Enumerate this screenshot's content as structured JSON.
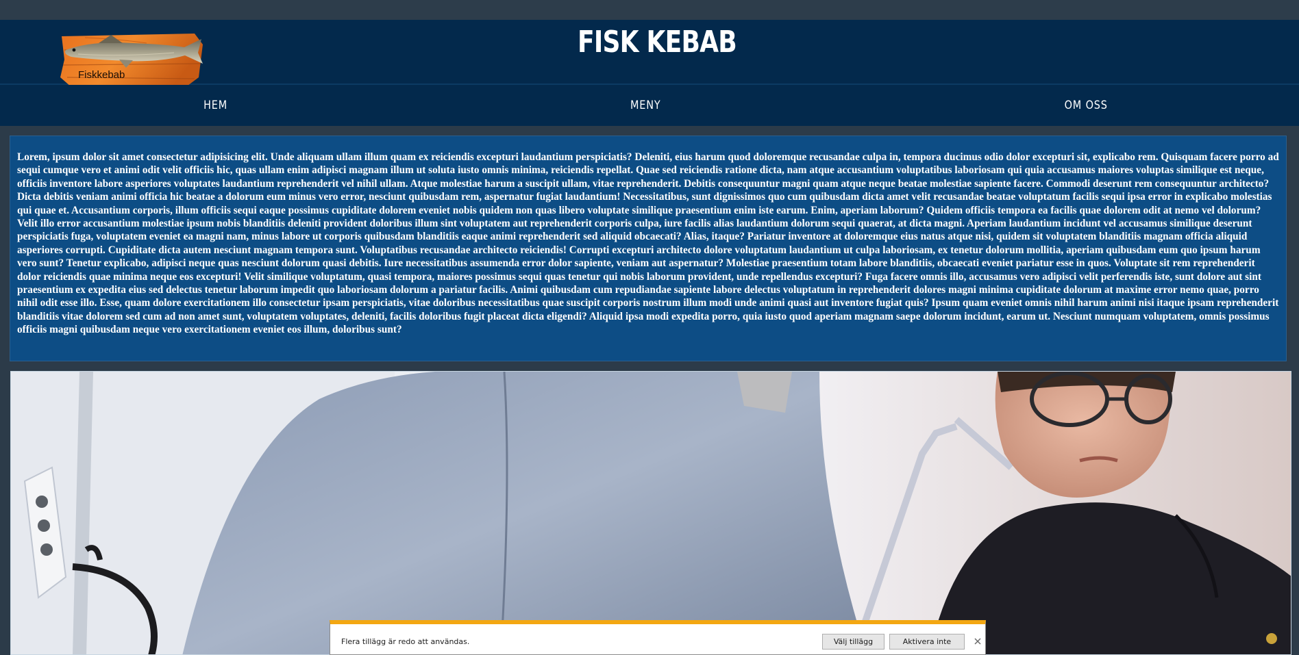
{
  "site": {
    "title": "FISK KEBAB",
    "logo_text": "Fiskkebab"
  },
  "nav": {
    "items": [
      {
        "label": "HEM"
      },
      {
        "label": "MENY"
      },
      {
        "label": "OM OSS"
      }
    ]
  },
  "content": {
    "paragraph": "Lorem, ipsum dolor sit amet consectetur adipisicing elit. Unde aliquam ullam illum quam ex reiciendis excepturi laudantium perspiciatis? Deleniti, eius harum quod doloremque recusandae culpa in, tempora ducimus odio dolor excepturi sit, explicabo rem. Quisquam facere porro ad sequi cumque vero et animi odit velit officiis hic, quas ullam enim adipisci magnam illum ut soluta iusto omnis minima, reiciendis repellat. Quae sed reiciendis ratione dicta, nam atque accusantium voluptatibus laboriosam qui quia accusamus maiores voluptas similique est neque, officiis inventore labore asperiores voluptates laudantium reprehenderit vel nihil ullam. Atque molestiae harum a suscipit ullam, vitae reprehenderit. Debitis consequuntur magni quam atque neque beatae molestiae sapiente facere. Commodi deserunt rem consequuntur architecto? Dicta debitis veniam animi officia hic beatae a dolorum eum minus vero error, nesciunt quibusdam rem, aspernatur fugiat laudantium! Necessitatibus, sunt dignissimos quo cum quibusdam dicta amet velit recusandae beatae voluptatum facilis sequi ipsa error in explicabo molestias qui quae et. Accusantium corporis, illum officiis sequi eaque possimus cupiditate dolorem eveniet nobis quidem non quas libero voluptate similique praesentium enim iste earum. Enim, aperiam laborum? Quidem officiis tempora ea facilis quae dolorem odit at nemo vel dolorum? Velit illo error accusantium molestiae ipsum nobis blanditiis deleniti provident doloribus illum sint voluptatem aut reprehenderit corporis culpa, iure facilis alias laudantium dolorum sequi quaerat, at dicta magni. Aperiam laudantium incidunt vel accusamus similique deserunt perspiciatis fuga, voluptatem eveniet ea magni nam, minus labore ut corporis quibusdam blanditiis eaque animi reprehenderit sed aliquid obcaecati? Alias, itaque? Pariatur inventore at doloremque eius natus atque nisi, quidem sit voluptatem blanditiis magnam officia aliquid asperiores corrupti. Cupiditate dicta autem nesciunt magnam tempora sunt. Voluptatibus recusandae architecto reiciendis! Corrupti excepturi architecto dolore voluptatum laudantium ut culpa laboriosam, ex tenetur dolorum mollitia, aperiam quibusdam eum quo ipsum harum vero sunt? Tenetur explicabo, adipisci neque quas nesciunt dolorum quasi debitis. Iure necessitatibus assumenda error dolor sapiente, veniam aut aspernatur? Molestiae praesentium totam labore blanditiis, obcaecati eveniet pariatur esse in quos. Voluptate sit rem reprehenderit dolor reiciendis quae minima neque eos excepturi! Velit similique voluptatum, quasi tempora, maiores possimus sequi quas tenetur qui nobis laborum provident, unde repellendus excepturi? Fuga facere omnis illo, accusamus vero adipisci velit perferendis iste, sunt dolore aut sint praesentium ex expedita eius sed delectus tenetur laborum impedit quo laboriosam dolorum a pariatur facilis. Animi quibusdam cum repudiandae sapiente labore delectus voluptatum in reprehenderit dolores magni minima cupiditate dolorum at maxime error nemo quae, porro nihil odit esse illo. Esse, quam dolore exercitationem illo consectetur ipsam perspiciatis, vitae doloribus necessitatibus quae suscipit corporis nostrum illum modi unde animi quasi aut inventore fugiat quis? Ipsum quam eveniet omnis nihil harum animi nisi itaque ipsam reprehenderit blanditiis vitae dolorem sed cum ad non amet sunt, voluptatem voluptates, deleniti, facilis doloribus fugit placeat dicta eligendi? Aliquid ipsa modi expedita porro, quia iusto quod aperiam magnam saepe dolorum incidunt, earum ut. Nesciunt numquam voluptatem, omnis possimus officiis magni quibusdam neque vero exercitationem eveniet eos illum, doloribus sunt?"
  },
  "notification": {
    "message": "Flera tillägg är redo att användas.",
    "primary_button": "Välj tillägg",
    "secondary_button": "Aktivera inte",
    "close_glyph": "✕"
  },
  "colors": {
    "header_bg": "#03294c",
    "page_bg": "#2c3b49",
    "text_box_bg": "#0d4d85",
    "notification_accent": "#f3a712"
  },
  "icons": {
    "logo": "fish-on-wood-logo",
    "close": "close-icon"
  }
}
